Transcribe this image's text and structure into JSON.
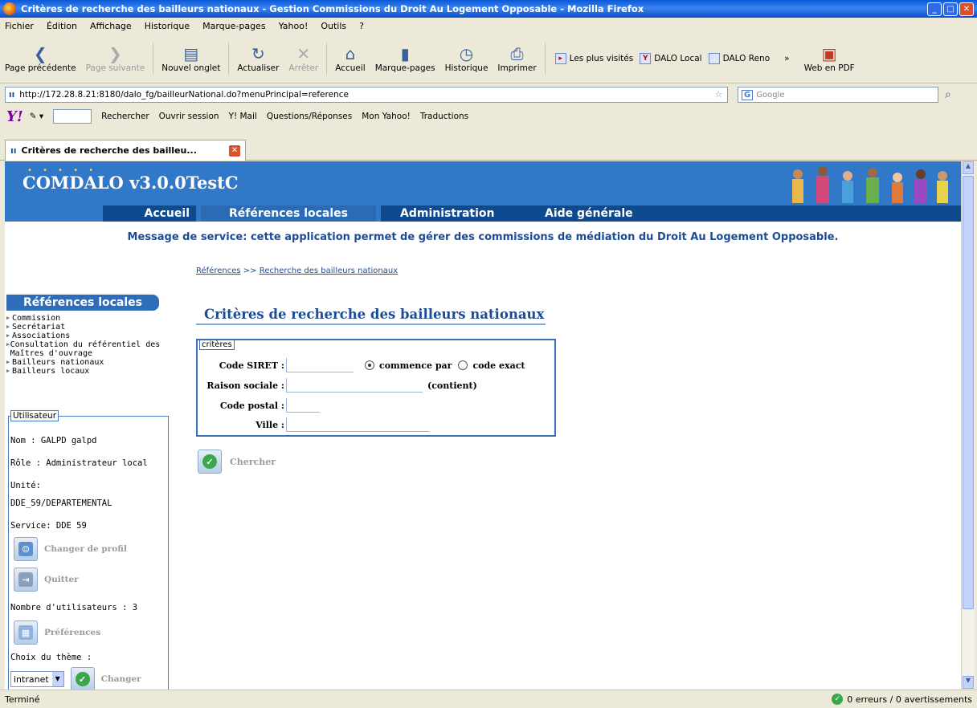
{
  "window": {
    "title": "Critères de recherche des bailleurs nationaux - Gestion Commissions du Droit Au Logement Opposable - Mozilla Firefox"
  },
  "menu": [
    "Fichier",
    "Édition",
    "Affichage",
    "Historique",
    "Marque-pages",
    "Yahoo!",
    "Outils",
    "?"
  ],
  "toolbar": {
    "back": "Page précédente",
    "forward": "Page suivante",
    "new_tab": "Nouvel onglet",
    "reload": "Actualiser",
    "stop": "Arrêter",
    "home": "Accueil",
    "bookmarks": "Marque-pages",
    "history": "Historique",
    "print": "Imprimer",
    "bm_most": "Les plus visités",
    "bm_dalo_local": "DALO Local",
    "bm_dalo_reno": "DALO Reno",
    "web_pdf": "Web en PDF"
  },
  "url": "http://172.28.8.21:8180/dalo_fg/bailleurNational.do?menuPrincipal=reference",
  "search_placeholder": "Google",
  "yahoo_bar": {
    "search": "Rechercher",
    "session": "Ouvrir session",
    "mail": "Y! Mail",
    "qa": "Questions/Réponses",
    "my": "Mon Yahoo!",
    "trad": "Traductions"
  },
  "tab": {
    "label": "Critères de recherche des bailleu..."
  },
  "app": {
    "logo": "COMDALO v3.0.0TestC",
    "nav": [
      "Accueil",
      "Références locales",
      "Administration",
      "Aide générale"
    ],
    "service_message": "Message de service: cette application permet de gérer des commissions de médiation du Droit Au Logement Opposable.",
    "breadcrumb": {
      "root": "Références",
      "sep": ">>",
      "current": "Recherche des bailleurs nationaux"
    },
    "page_title": "Critères de recherche des bailleurs nationaux",
    "form": {
      "legend": "critères",
      "siret": "Code SIRET :",
      "starts_with": "commence par",
      "exact": "code exact",
      "raison": "Raison sociale :",
      "contient": "(contient)",
      "postal": "Code postal :",
      "ville": "Ville :"
    },
    "search_button": "Chercher"
  },
  "sidebar": {
    "title": "Références locales",
    "items": [
      "Commission",
      "Secrétariat",
      "Associations",
      "Consultation du référentiel des Maîtres d'ouvrage",
      "Bailleurs nationaux",
      "Bailleurs locaux"
    ],
    "user": {
      "legend": "Utilisateur",
      "nom": "Nom : GALPD galpd",
      "role": "Rôle : Administrateur local",
      "unite_label": "Unité:",
      "unite": "DDE_59/DEPARTEMENTAL",
      "service": "Service: DDE 59",
      "change_profile": "Changer de profil",
      "quit": "Quitter",
      "count": "Nombre d'utilisateurs : 3",
      "prefs": "Préférences",
      "theme_label": "Choix du thème :",
      "theme_value": "intranet",
      "change": "Changer"
    }
  },
  "status": {
    "left": "Terminé",
    "right": "0 erreurs / 0 avertissements"
  }
}
